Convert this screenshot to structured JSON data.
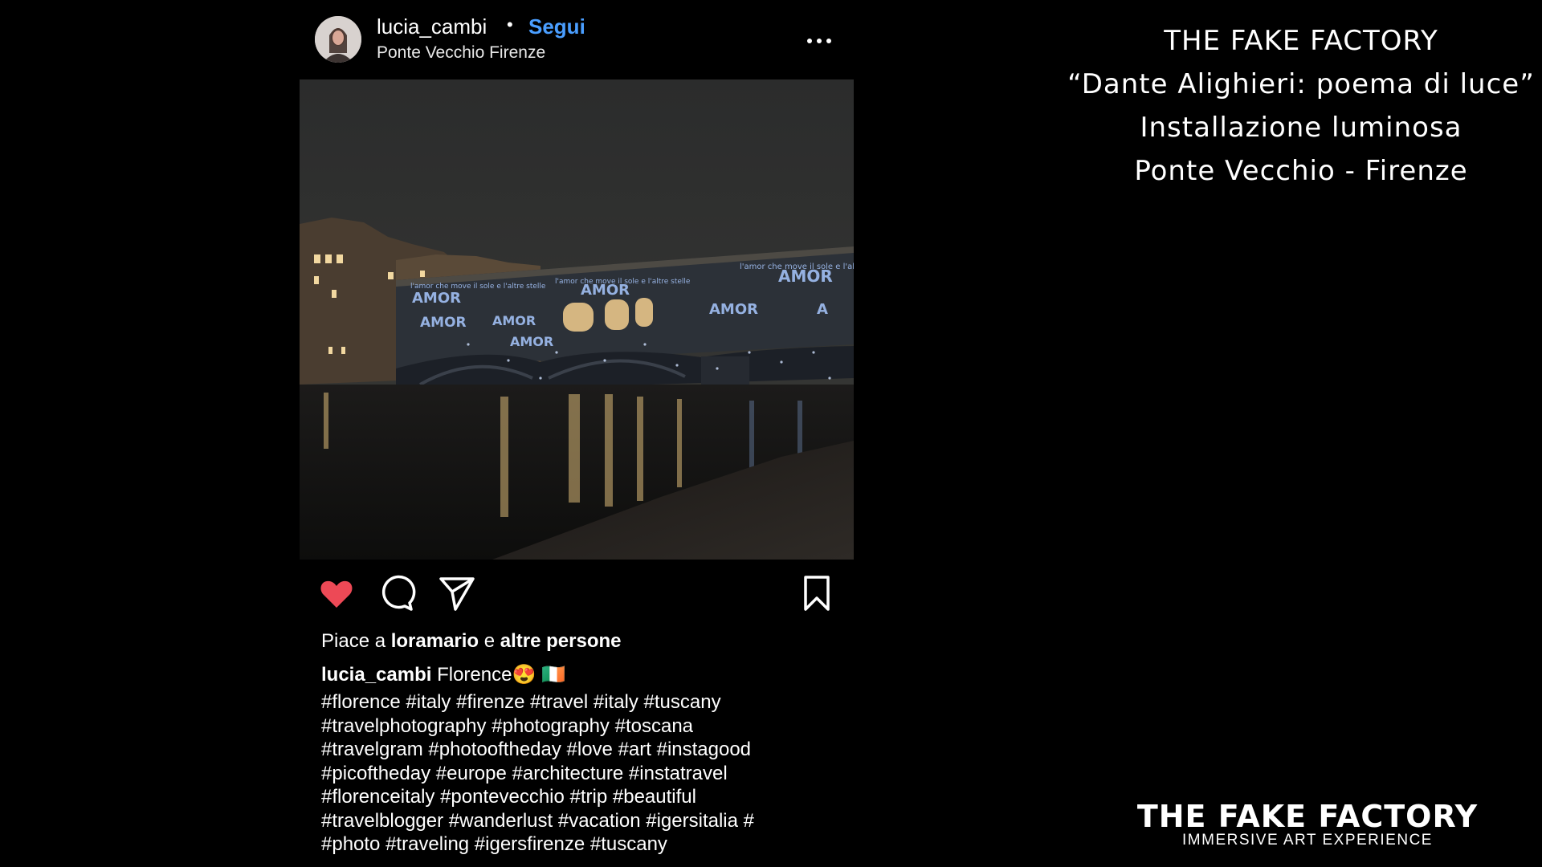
{
  "post": {
    "username": "lucia_cambi",
    "separator": "•",
    "follow_label": "Segui",
    "location": "Ponte Vecchio Firenze",
    "more_icon": "more-horizontal-icon",
    "photo_alt": "Ponte Vecchio at night with projected light installation",
    "photo_projection_texts": [
      "AMOR",
      "l'amor che move il sole e l'altre stelle"
    ],
    "actions": {
      "like_icon": "heart-filled-icon",
      "comment_icon": "comment-icon",
      "share_icon": "send-icon",
      "save_icon": "bookmark-icon",
      "like_color": "#ed4956"
    },
    "likes": {
      "prefix": "Piace a ",
      "user": "loramario",
      "middle": " e ",
      "others": "altre persone"
    },
    "caption": {
      "user": "lucia_cambi",
      "text": "Florence",
      "emoji_face": "😍",
      "emoji_flag": "🇮🇪"
    },
    "hashtag_lines": [
      "#florence #italy #firenze #travel #italy #tuscany",
      "#travelphotography #photography #toscana",
      "#travelgram #photooftheday #love #art #instagood",
      "#picoftheday #europe #architecture #instatravel",
      "#florenceitaly #pontevecchio #trip #beautiful",
      "#travelblogger #wanderlust #vacation #igersitalia #",
      "#photo #traveling #igersfirenze #tuscany"
    ],
    "follow_color": "#4a9eff"
  },
  "title": {
    "line1": "THE FAKE FACTORY",
    "line2": "“Dante Alighieri: poema di luce”",
    "line3": "Installazione luminosa",
    "line4": "Ponte Vecchio - Firenze"
  },
  "logo": {
    "main": "THE FAKE FACTORY",
    "sub": "IMMERSIVE ART EXPERIENCE"
  }
}
